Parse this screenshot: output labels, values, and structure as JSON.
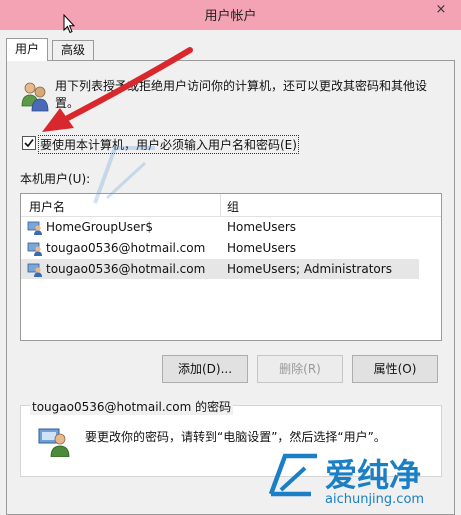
{
  "window": {
    "title": "用户帐户",
    "close_symbol": "×"
  },
  "tabs": [
    {
      "label": "用户"
    },
    {
      "label": "高级"
    }
  ],
  "intro_text": "用下列表授予或拒绝用户访问你的计算机，还可以更改其密码和其他设置。",
  "require_checkbox": {
    "checked": true,
    "label": "要使用本计算机，用户必须输入用户名和密码(E)"
  },
  "local_users_label": "本机用户(U):",
  "users_table": {
    "columns": [
      "用户名",
      "组"
    ],
    "rows": [
      {
        "name": "HomeGroupUser$",
        "group": "HomeUsers"
      },
      {
        "name": "tougao0536@hotmail.com",
        "group": "HomeUsers"
      },
      {
        "name": "tougao0536@hotmail.com",
        "group": "HomeUsers; Administrators"
      }
    ]
  },
  "buttons": {
    "add": "添加(D)...",
    "remove": "删除(R)",
    "properties": "属性(O)"
  },
  "password_group": {
    "title": "tougao0536@hotmail.com 的密码",
    "message": "要更改你的密码，请转到“电脑设置”，然后选择“用户”。"
  },
  "watermark": {
    "brand": "爱纯净",
    "url": "aichunjing.com"
  },
  "colors": {
    "titlebar": "#f4a3b4",
    "arrow": "#d9282d",
    "watermark": "#1a7fc4"
  }
}
